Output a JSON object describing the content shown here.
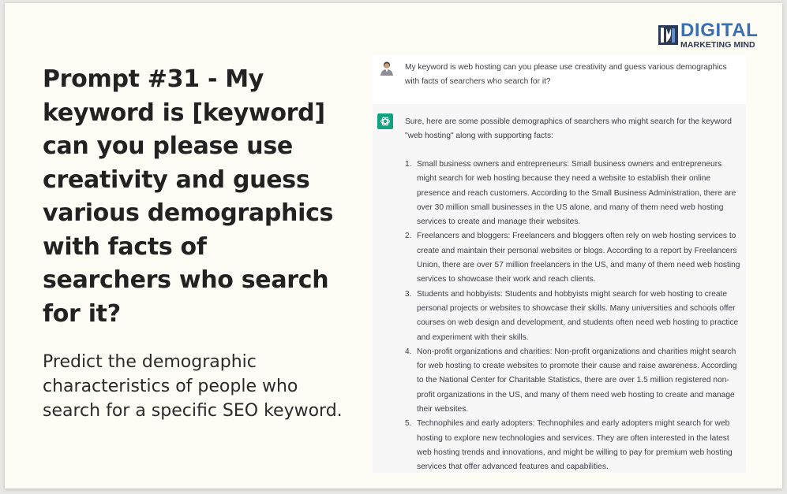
{
  "title": "Prompt #31 - My keyword is [keyword] can you please use creativity and guess various demographics with facts of searchers who search for it?",
  "subtitle": "Predict the demographic characteristics of people who search for a specific SEO keyword.",
  "logo": {
    "line1": "DIGITAL",
    "line2": "MARKETING MIND",
    "colors": {
      "primary": "#3a6fb5",
      "secondary": "#2c3a54"
    }
  },
  "chat": {
    "user_message": "My keyword is web hosting can you please use creativity and guess various demographics with facts of searchers who search for it?",
    "assistant_intro": "Sure, here are some possible demographics of searchers who might search for the keyword \"web hosting\" along with supporting facts:",
    "items": [
      {
        "num": "1.",
        "text": "Small business owners and entrepreneurs: Small business owners and entrepreneurs might search for web hosting because they need a website to establish their online presence and reach customers. According to the Small Business Administration, there are over 30 million small businesses in the US alone, and many of them need web hosting services to create and manage their websites."
      },
      {
        "num": "2.",
        "text": "Freelancers and bloggers: Freelancers and bloggers often rely on web hosting services to create and maintain their personal websites or blogs. According to a report by Freelancers Union, there are over 57 million freelancers in the US, and many of them need web hosting services to showcase their work and reach clients."
      },
      {
        "num": "3.",
        "text": "Students and hobbyists: Students and hobbyists might search for web hosting to create personal projects or websites to showcase their skills. Many universities and schools offer courses on web design and development, and students often need web hosting to practice and experiment with their skills."
      },
      {
        "num": "4.",
        "text": "Non-profit organizations and charities: Non-profit organizations and charities might search for web hosting to create websites to promote their cause and raise awareness. According to the National Center for Charitable Statistics, there are over 1.5 million registered non-profit organizations in the US, and many of them need web hosting to create and manage their websites."
      },
      {
        "num": "5.",
        "text": "Technophiles and early adopters: Technophiles and early adopters might search for web hosting to explore new technologies and services. They are often interested in the latest web hosting trends and innovations, and might be willing to pay for premium web hosting services that offer advanced features and capabilities."
      }
    ],
    "colors": {
      "assistant_bg": "#f7f7f8",
      "bot_icon": "#10a37f"
    }
  }
}
